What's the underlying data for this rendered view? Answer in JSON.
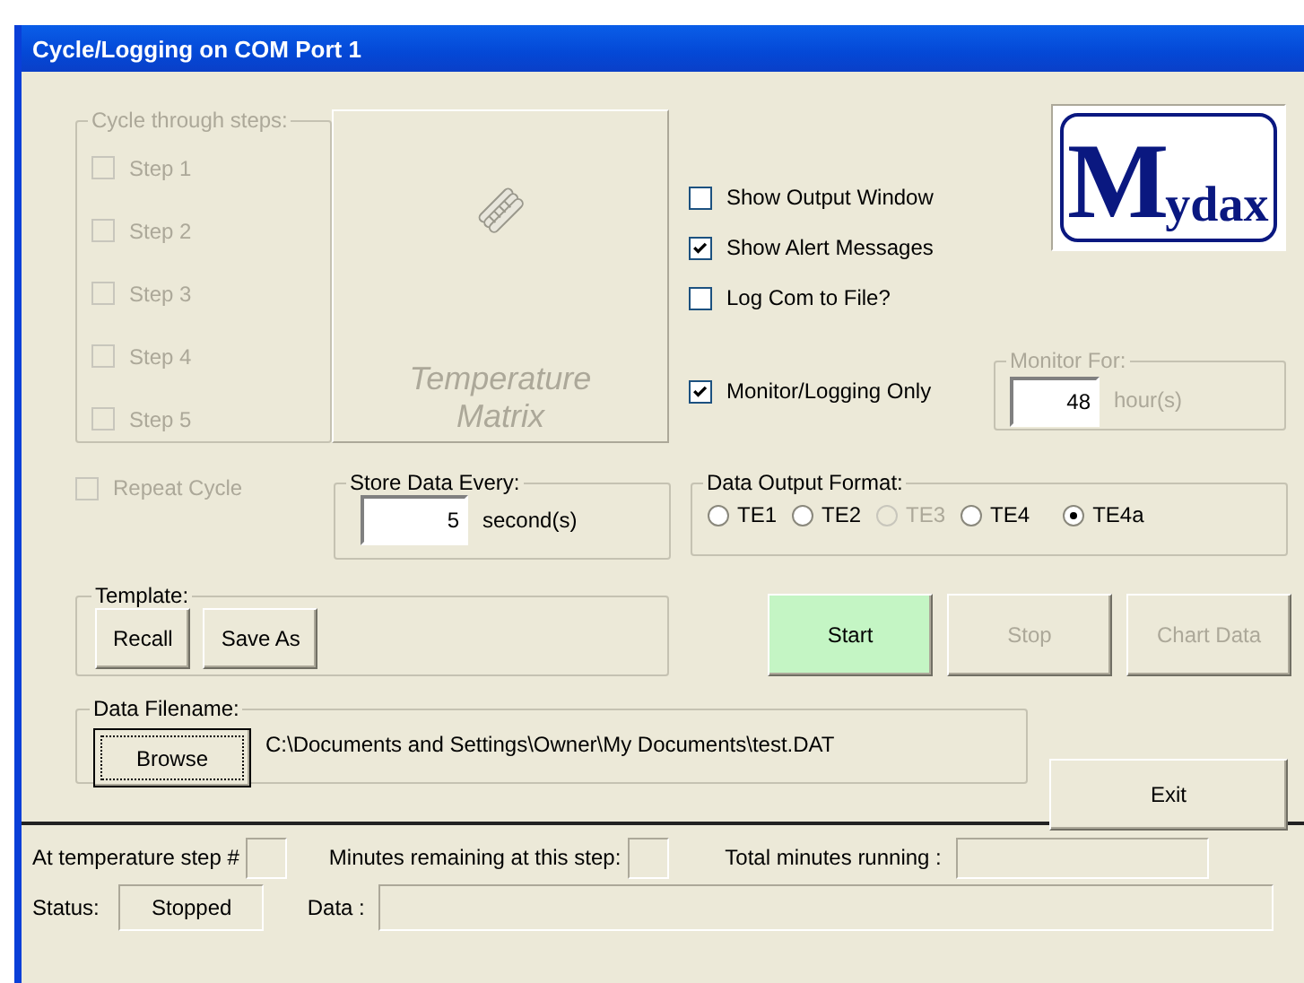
{
  "window": {
    "title": "Cycle/Logging on COM Port  1"
  },
  "cycle_group": {
    "label": "Cycle through steps:",
    "disabled": true,
    "steps": [
      {
        "label": "Step 1",
        "checked": false
      },
      {
        "label": "Step 2",
        "checked": false
      },
      {
        "label": "Step 3",
        "checked": false
      },
      {
        "label": "Step 4",
        "checked": false
      },
      {
        "label": "Step 5",
        "checked": false
      }
    ]
  },
  "matrix_button": {
    "label": "Temperature Matrix",
    "disabled": true
  },
  "options": [
    {
      "label": "Show Output Window",
      "checked": false
    },
    {
      "label": "Show Alert Messages",
      "checked": true
    },
    {
      "label": "Log Com to File?",
      "checked": false
    }
  ],
  "logo": {
    "initial": "M",
    "rest": "ydax"
  },
  "monitor_only": {
    "label": "Monitor/Logging Only",
    "checked": true
  },
  "monitor_for": {
    "label": "Monitor For:",
    "value": "48",
    "unit": "hour(s)",
    "disabled": true
  },
  "repeat_cycle": {
    "label": "Repeat Cycle",
    "checked": false,
    "disabled": true
  },
  "store_every": {
    "label": "Store Data Every:",
    "value": "5",
    "unit": "second(s)"
  },
  "output_format": {
    "label": "Data Output Format:",
    "options": [
      {
        "label": "TE1",
        "selected": false,
        "disabled": false
      },
      {
        "label": "TE2",
        "selected": false,
        "disabled": false
      },
      {
        "label": "TE3",
        "selected": false,
        "disabled": true
      },
      {
        "label": "TE4",
        "selected": false,
        "disabled": false
      },
      {
        "label": "TE4a",
        "selected": true,
        "disabled": false
      }
    ]
  },
  "template": {
    "label": "Template:",
    "buttons": [
      "Recall",
      "Save As"
    ]
  },
  "actions": [
    {
      "label": "Start",
      "highlighted": true,
      "disabled": false
    },
    {
      "label": "Stop",
      "highlighted": false,
      "disabled": true
    },
    {
      "label": "Chart Data",
      "highlighted": false,
      "disabled": true
    }
  ],
  "filename": {
    "label": "Data Filename:",
    "button": "Browse",
    "path": "C:\\Documents and Settings\\Owner\\My Documents\\test.DAT"
  },
  "exit_button": {
    "label": "Exit"
  },
  "status_bar": {
    "step_label": "At temperature step #",
    "minutes_label": "Minutes remaining at this step:",
    "total_label": "Total minutes running :",
    "status_label": "Status:",
    "status_value": "Stopped",
    "data_label": "Data :"
  }
}
